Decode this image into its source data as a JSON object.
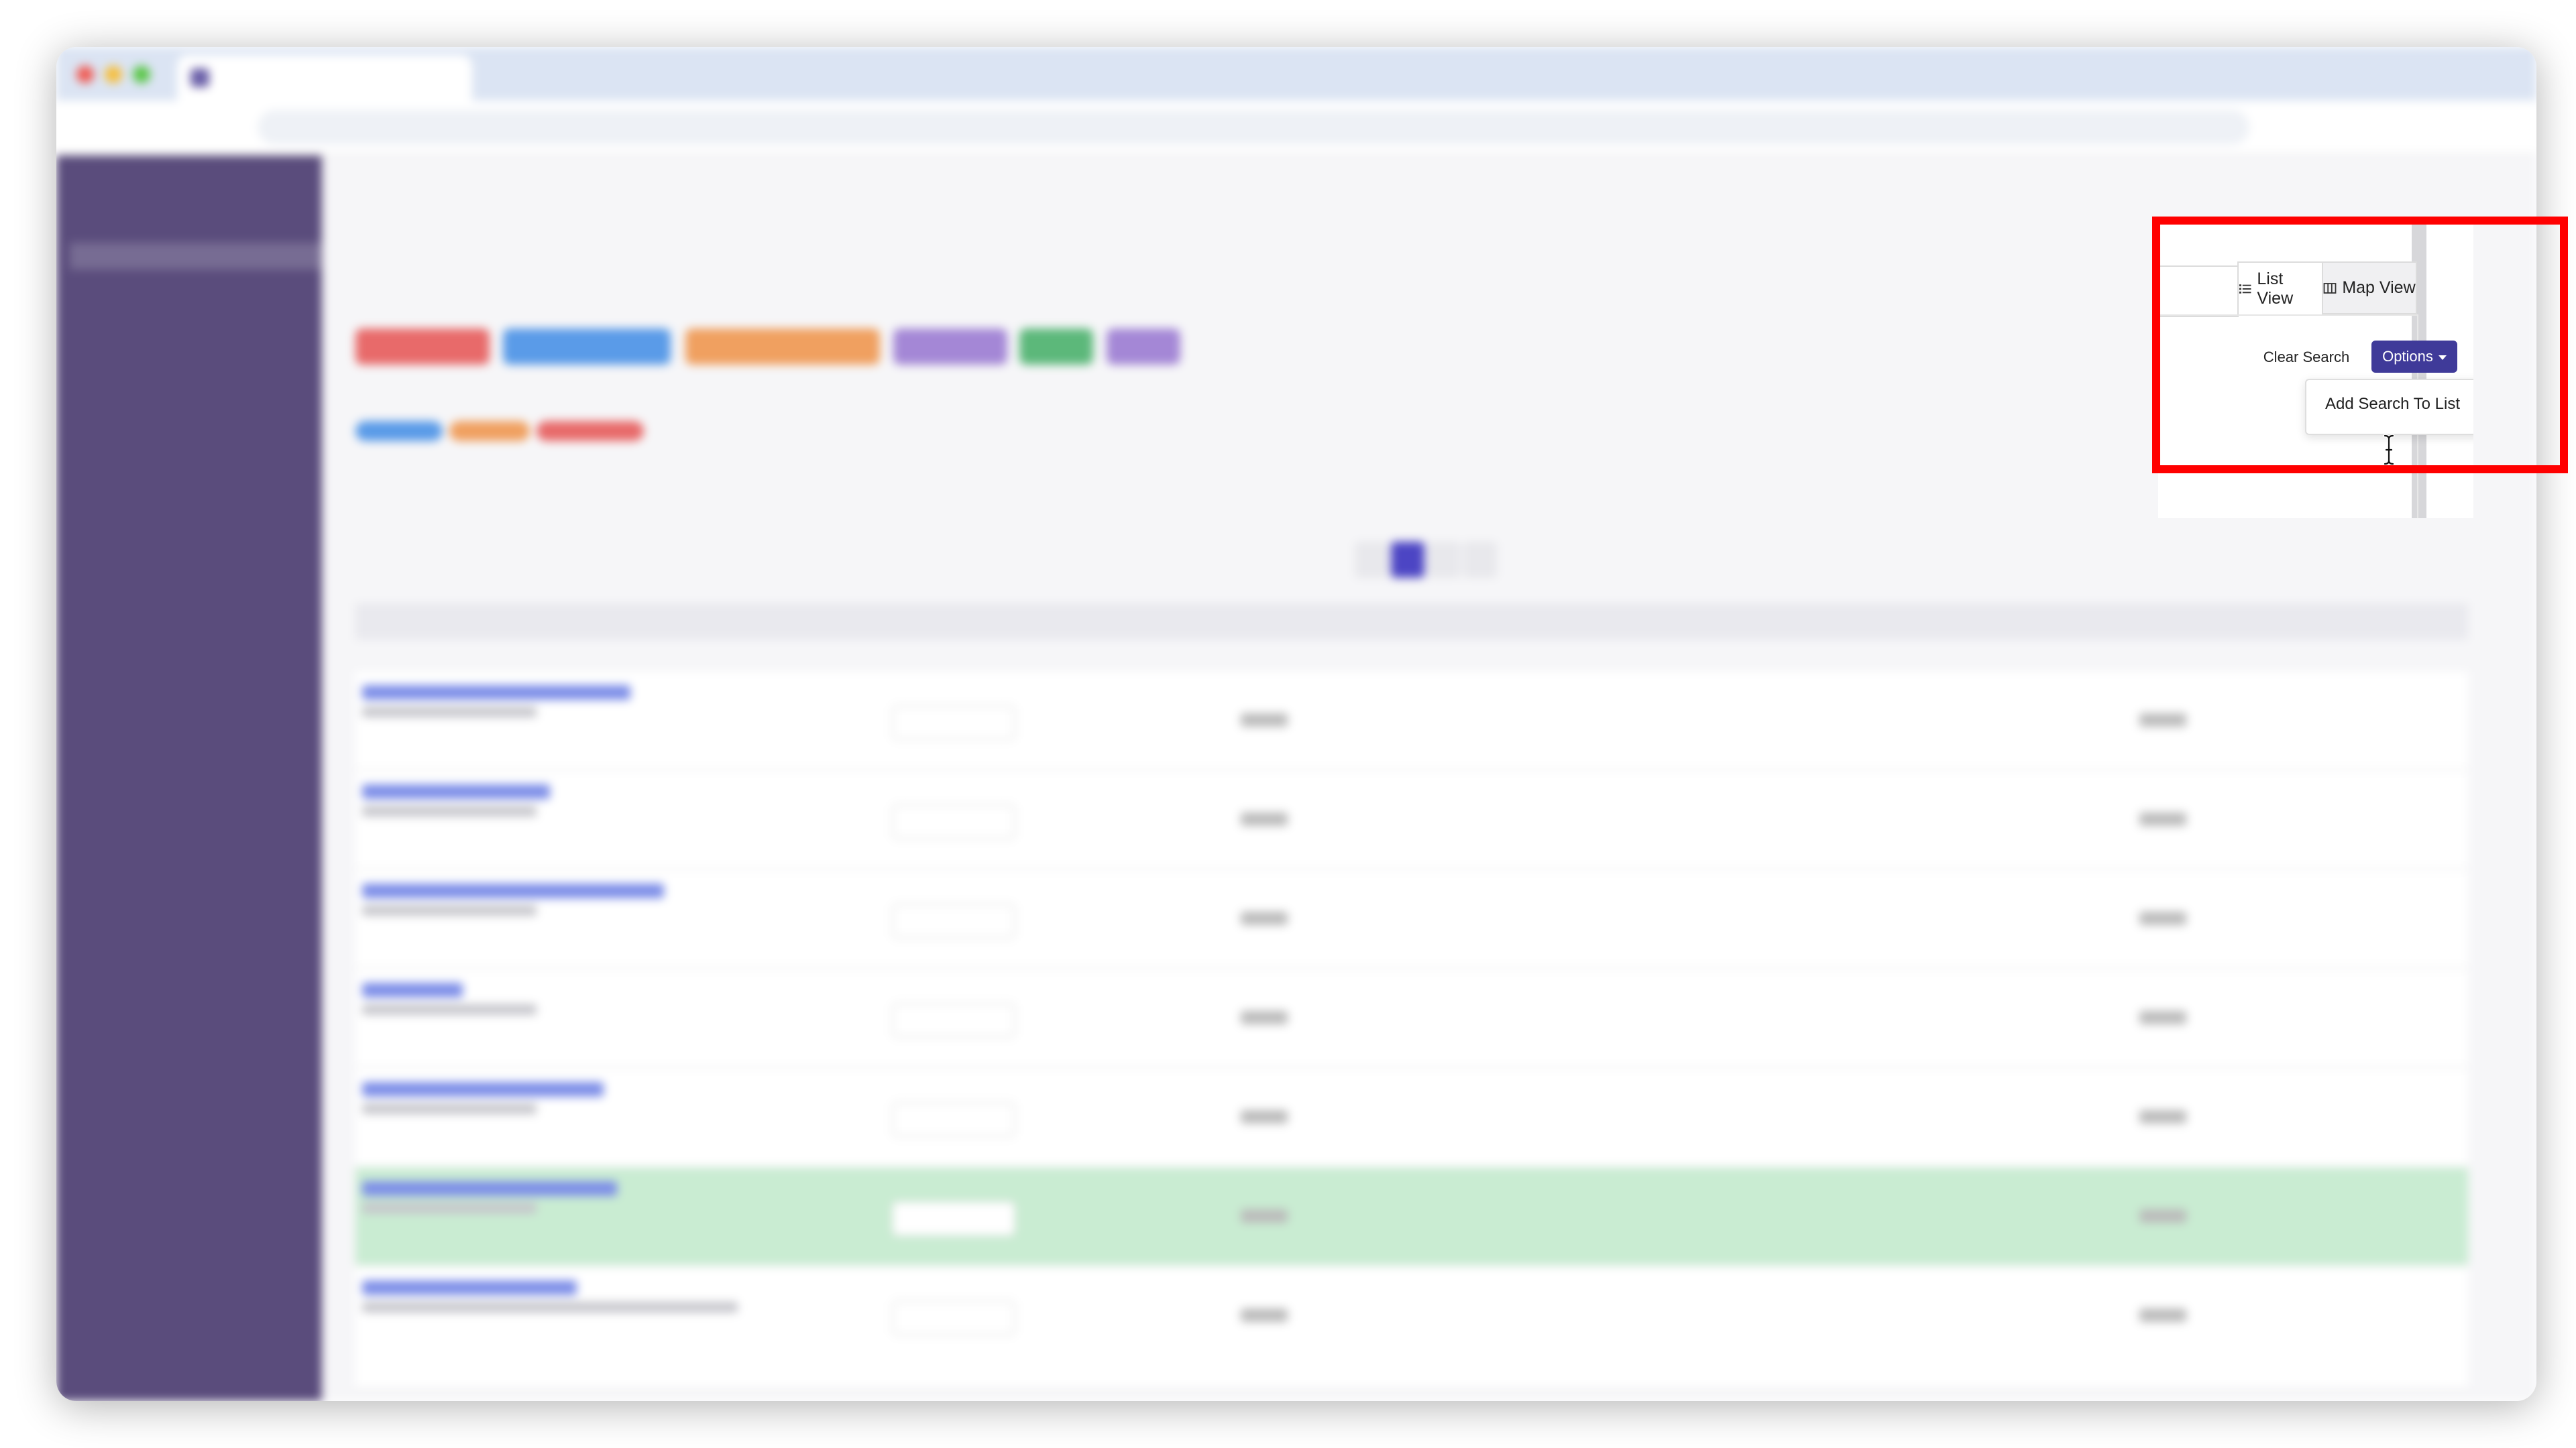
{
  "view_tabs": {
    "list_label": "List View",
    "map_label": "Map View",
    "list_icon": "list-icon",
    "map_icon": "map-icon"
  },
  "actions": {
    "clear_search_label": "Clear Search",
    "options_label": "Options",
    "options_color": "#3f3a99"
  },
  "options_menu": {
    "items": [
      "Add Search To List"
    ]
  },
  "highlight_color": "#ff0000"
}
